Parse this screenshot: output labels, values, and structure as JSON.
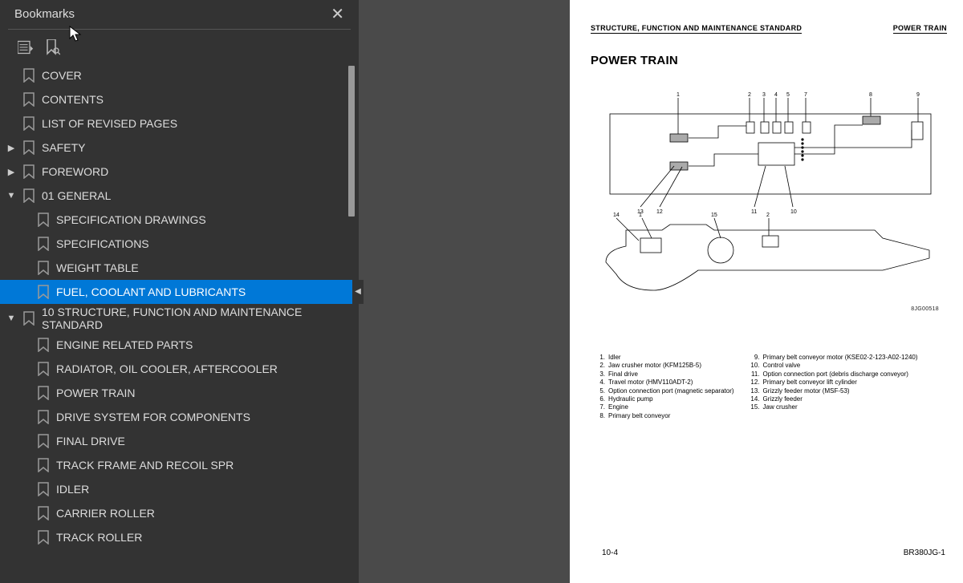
{
  "sidebar": {
    "title": "Bookmarks",
    "items": [
      {
        "label": "COVER",
        "level": 0,
        "caret": "none"
      },
      {
        "label": "CONTENTS",
        "level": 0,
        "caret": "none"
      },
      {
        "label": "LIST OF REVISED PAGES",
        "level": 0,
        "caret": "none"
      },
      {
        "label": "SAFETY",
        "level": 0,
        "caret": "right"
      },
      {
        "label": "FOREWORD",
        "level": 0,
        "caret": "right"
      },
      {
        "label": "01 GENERAL",
        "level": 0,
        "caret": "down"
      },
      {
        "label": "SPECIFICATION DRAWINGS",
        "level": 1,
        "caret": "none"
      },
      {
        "label": "SPECIFICATIONS",
        "level": 1,
        "caret": "none"
      },
      {
        "label": "WEIGHT TABLE",
        "level": 1,
        "caret": "none"
      },
      {
        "label": "FUEL, COOLANT AND LUBRICANTS",
        "level": 1,
        "caret": "none",
        "selected": true
      },
      {
        "label": "10 STRUCTURE, FUNCTION AND MAINTENANCE STANDARD",
        "level": 0,
        "caret": "down"
      },
      {
        "label": "ENGINE RELATED PARTS",
        "level": 1,
        "caret": "none"
      },
      {
        "label": "RADIATOR, OIL COOLER, AFTERCOOLER",
        "level": 1,
        "caret": "none"
      },
      {
        "label": "POWER TRAIN",
        "level": 1,
        "caret": "none"
      },
      {
        "label": "DRIVE SYSTEM FOR COMPONENTS",
        "level": 1,
        "caret": "none"
      },
      {
        "label": "FINAL DRIVE",
        "level": 1,
        "caret": "none"
      },
      {
        "label": "TRACK FRAME AND RECOIL SPR",
        "level": 1,
        "caret": "none"
      },
      {
        "label": "IDLER",
        "level": 1,
        "caret": "none"
      },
      {
        "label": "CARRIER ROLLER",
        "level": 1,
        "caret": "none"
      },
      {
        "label": "TRACK ROLLER",
        "level": 1,
        "caret": "none"
      }
    ]
  },
  "page": {
    "header_left": "STRUCTURE, FUNCTION AND MAINTENANCE STANDARD",
    "header_right": "POWER TRAIN",
    "title": "POWER TRAIN",
    "figure_id": "8JG00518",
    "legend_left": [
      {
        "n": "1.",
        "t": "Idler"
      },
      {
        "n": "2.",
        "t": "Jaw crusher motor (KFM125B-5)"
      },
      {
        "n": "3.",
        "t": "Final drive"
      },
      {
        "n": "4.",
        "t": "Travel motor (HMV110ADT-2)"
      },
      {
        "n": "5.",
        "t": "Option connection port (magnetic separator)"
      },
      {
        "n": "6.",
        "t": "Hydraulic pump"
      },
      {
        "n": "7.",
        "t": "Engine"
      },
      {
        "n": "8.",
        "t": "Primary belt conveyor"
      }
    ],
    "legend_right": [
      {
        "n": "9.",
        "t": "Primary belt conveyor motor (KSE02-2-123-A02-1240)"
      },
      {
        "n": "10.",
        "t": "Control valve"
      },
      {
        "n": "11.",
        "t": "Option connection port (debris discharge conveyor)"
      },
      {
        "n": "12.",
        "t": "Primary belt conveyor lift cylinder"
      },
      {
        "n": "13.",
        "t": "Grizzly feeder motor (MSF-53)"
      },
      {
        "n": "14.",
        "t": "Grizzly feeder"
      },
      {
        "n": "15.",
        "t": "Jaw crusher"
      }
    ],
    "footer_left": "10-4",
    "footer_right": "BR380JG-1"
  }
}
